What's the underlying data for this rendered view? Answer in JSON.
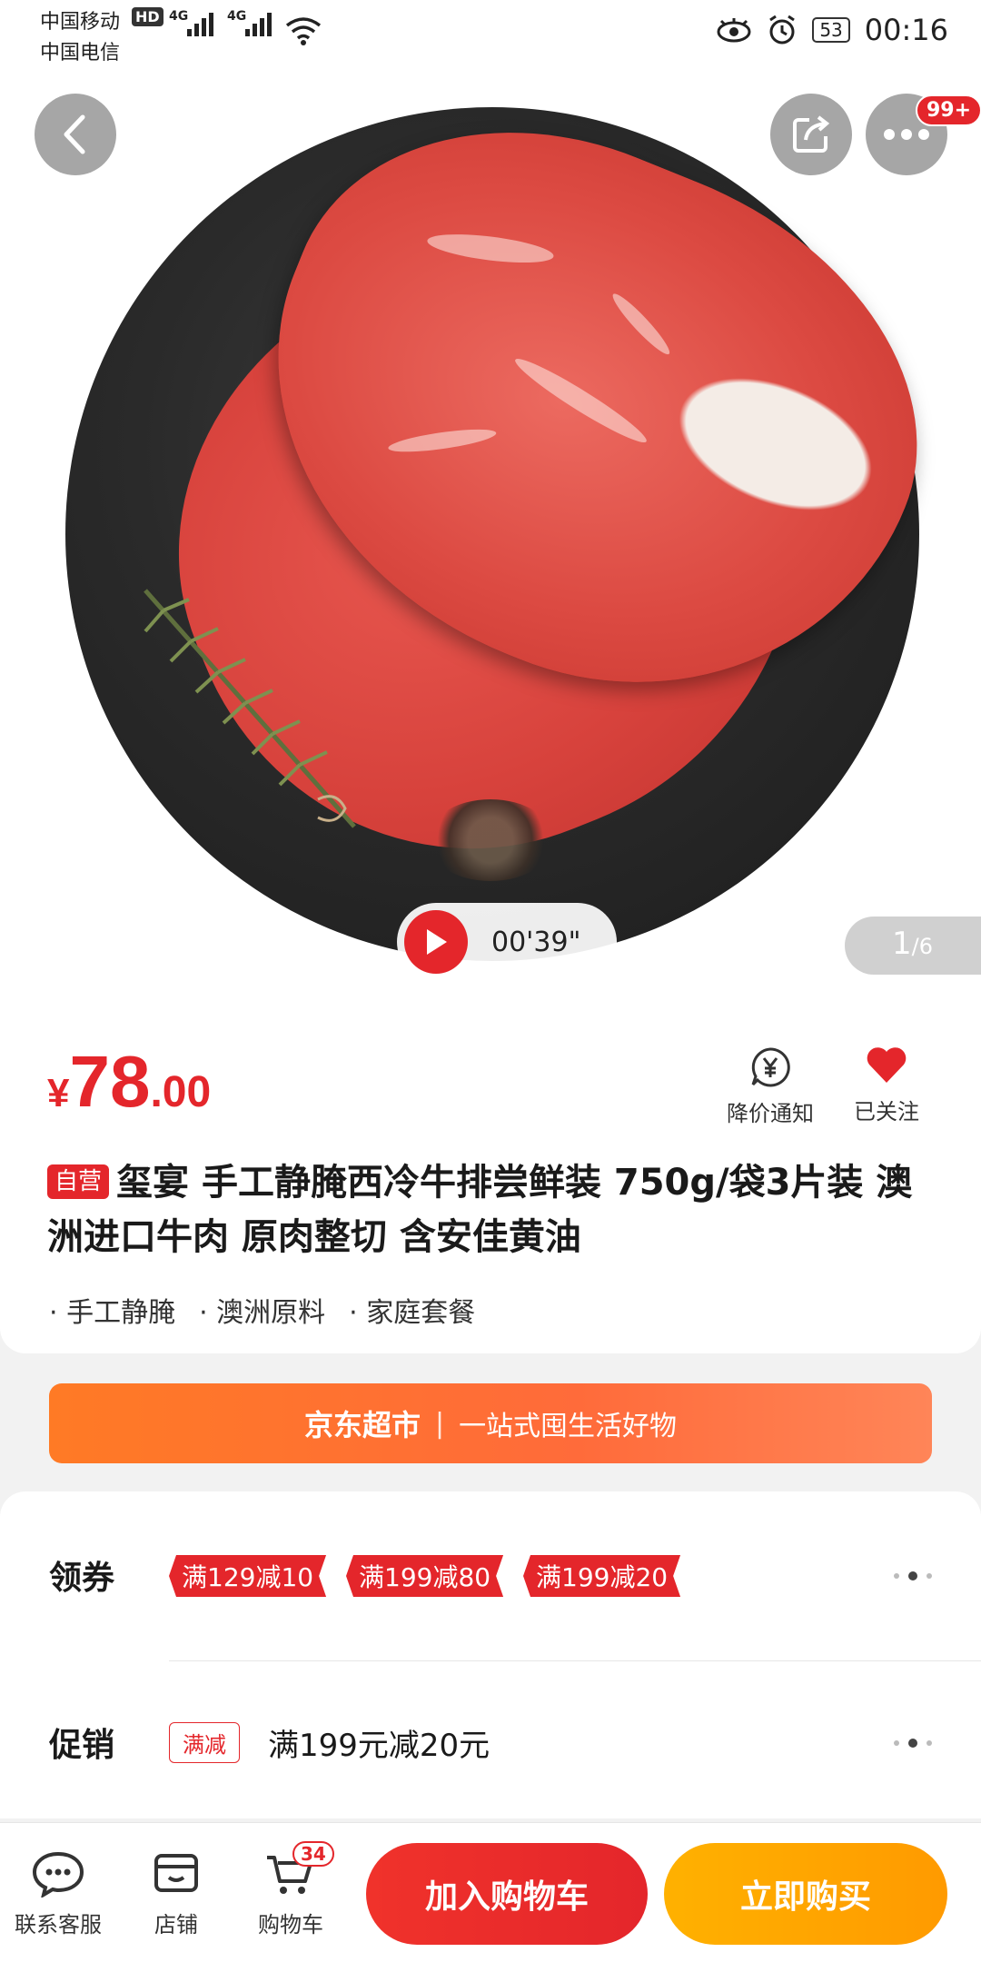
{
  "status_bar": {
    "carrier_primary": "中国移动",
    "carrier_secondary": "中国电信",
    "hd_label": "HD",
    "network_1": "4G",
    "network_2": "4G",
    "battery": "53",
    "time": "00:16"
  },
  "header": {
    "back_icon": "chevron-left-icon",
    "share_icon": "share-icon",
    "more_icon": "more-dots-icon",
    "more_badge": "99+"
  },
  "media": {
    "video_duration": "00'39\"",
    "page_current": "1",
    "page_total": "/6"
  },
  "product": {
    "currency": "¥",
    "price_integer": "78",
    "price_decimal": ".00",
    "price_alert_label": "降价通知",
    "follow_label": "已关注",
    "self_operated_tag": "自营",
    "title": "玺宴 手工静腌西冷牛排尝鲜装 750g/袋3片装 澳洲进口牛肉 原肉整切 含安佳黄油",
    "feature_tags": [
      "手工静腌",
      "澳洲原料",
      "家庭套餐"
    ]
  },
  "banner": {
    "brand": "京东超市",
    "separator": "|",
    "slogan": "一站式囤生活好物"
  },
  "coupons": {
    "label": "领券",
    "items": [
      "满129减10",
      "满199减80",
      "满199减20"
    ]
  },
  "promotion": {
    "label": "促销",
    "tag": "满减",
    "text": "满199元减20元"
  },
  "bottom_bar": {
    "service_label": "联系客服",
    "store_label": "店铺",
    "cart_label": "购物车",
    "cart_count": "34",
    "add_to_cart_label": "加入购物车",
    "buy_now_label": "立即购买"
  },
  "colors": {
    "primary_red": "#e4262b",
    "buy_orange": "#ff9a00",
    "banner_orange": "#ff7a25"
  }
}
